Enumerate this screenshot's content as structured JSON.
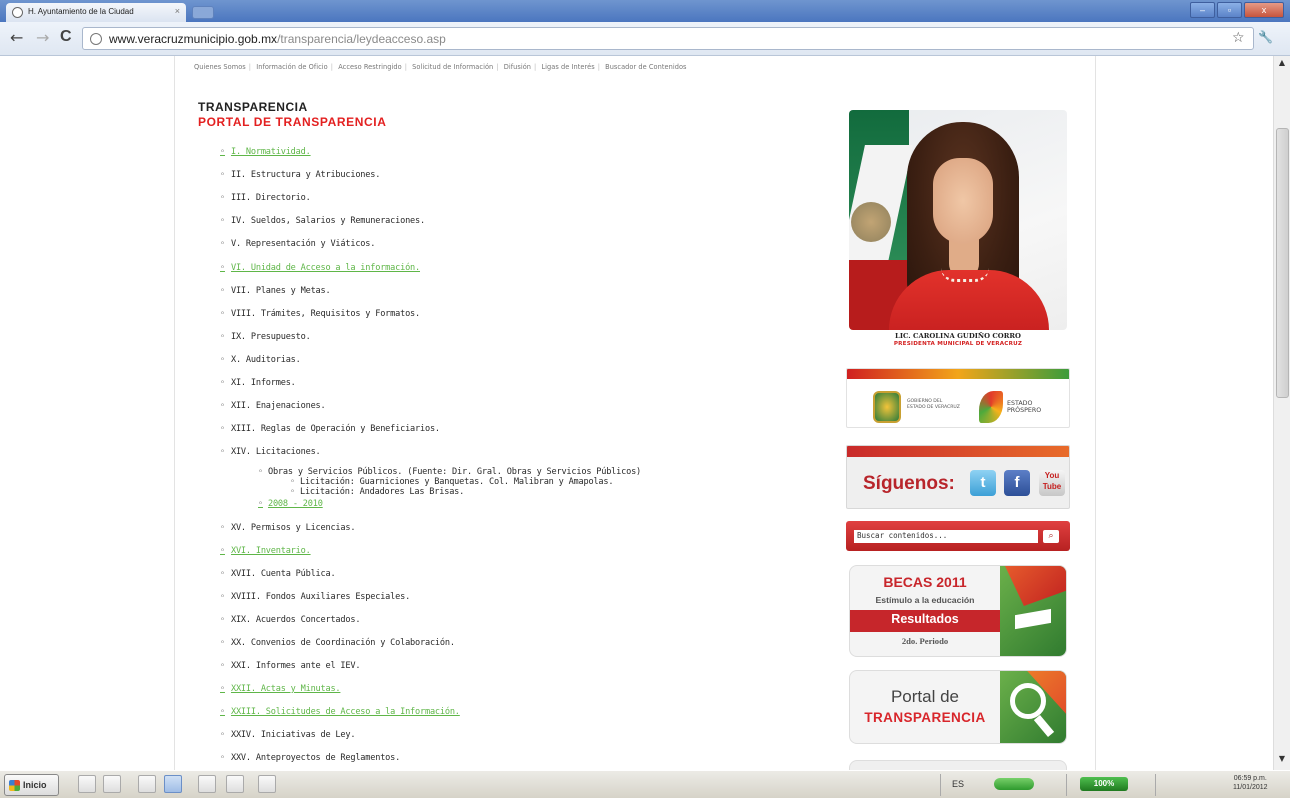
{
  "browser": {
    "tab_title": "H. Ayuntamiento de la Ciudad",
    "tab_close": "×",
    "url_host": "www.veracruzmunicipio.gob.mx",
    "url_path": "/transparencia/leydeacceso.asp",
    "back_icon": "←",
    "forward_icon": "→",
    "reload_icon": "C",
    "star_icon": "☆",
    "wrench_icon": "🔧",
    "window_buttons": [
      "–",
      "▫",
      "x"
    ]
  },
  "topnav": {
    "items": [
      "Quienes Somos",
      "Información de Oficio",
      "Acceso Restringido",
      "Solicitud de Información",
      "Difusión",
      "Ligas de Interés",
      "Buscador de Contenidos"
    ],
    "separator": "|"
  },
  "page": {
    "title": "TRANSPARENCIA",
    "subtitle": "PORTAL DE TRANSPARENCIA",
    "items": [
      {
        "label": "I. Normatividad.",
        "link": true
      },
      {
        "label": "II. Estructura y Atribuciones.",
        "link": false
      },
      {
        "label": "III. Directorio.",
        "link": false
      },
      {
        "label": "IV. Sueldos, Salarios y Remuneraciones.",
        "link": false
      },
      {
        "label": "V. Representación y Viáticos.",
        "link": false
      },
      {
        "label": "VI. Unidad de Acceso a la información.",
        "link": true
      },
      {
        "label": "VII. Planes y Metas.",
        "link": false
      },
      {
        "label": "VIII. Trámites, Requisitos y Formatos.",
        "link": false
      },
      {
        "label": "IX. Presupuesto.",
        "link": false
      },
      {
        "label": "X. Auditorias.",
        "link": false
      },
      {
        "label": "XI. Informes.",
        "link": false
      },
      {
        "label": "XII. Enajenaciones.",
        "link": false
      },
      {
        "label": "XIII. Reglas de Operación y Beneficiarios.",
        "link": false
      },
      {
        "label": "XIV. Licitaciones.",
        "link": false
      },
      {
        "label": "XV. Permisos y Licencias.",
        "link": false
      },
      {
        "label": "XVI. Inventario.",
        "link": true
      },
      {
        "label": "XVII. Cuenta Pública.",
        "link": false
      },
      {
        "label": "XVIII. Fondos Auxiliares Especiales.",
        "link": false
      },
      {
        "label": "XIX. Acuerdos Concertados.",
        "link": false
      },
      {
        "label": "XX. Convenios de Coordinación y Colaboración.",
        "link": false
      },
      {
        "label": "XXI. Informes ante el IEV.",
        "link": false
      },
      {
        "label": "XXII. Actas y Minutas.",
        "link": true
      },
      {
        "label": "XXIII. Solicitudes de Acceso a la Información.",
        "link": true
      },
      {
        "label": "XXIV. Iniciativas de Ley.",
        "link": false
      },
      {
        "label": "XXV. Anteproyectos de Reglamentos.",
        "link": false
      }
    ],
    "licitaciones_sub": {
      "obras": "Obras y Servicios Públicos. (Fuente: Dir. Gral. Obras y Servicios Públicos)",
      "lic1": "Licitación: Guarniciones y Banquetas. Col. Malibran y Amapolas.",
      "lic2": "Licitación: Andadores Las Brisas.",
      "years": "2008 - 2010"
    }
  },
  "sidebar": {
    "portrait_name": "LIC. CAROLINA GUDIÑO CORRO",
    "portrait_title": "PRESIDENTA MUNICIPAL DE VERACRUZ",
    "gob_text_1": "GOBIERNO DEL",
    "gob_text_2": "ESTADO DE VERACRUZ",
    "estado_1": "ESTADO",
    "estado_2": "PRÓSPERO",
    "siguenos": "Síguenos:",
    "twitter": "t",
    "facebook": "f",
    "youtube": "You Tube",
    "search_placeholder": "Buscar contenidos...",
    "search_go": "⌕",
    "becas_title": "BECAS 2011",
    "becas_sub": "Estímulo a la educación",
    "becas_result": "Resultados",
    "becas_period": "2do. Periodo",
    "portal_1": "Portal de",
    "portal_2": "TRANSPARENCIA"
  },
  "taskbar": {
    "start_label": "Inicio",
    "language": "ES",
    "battery_label": "100%",
    "time": "06:59 p.m.",
    "date": "11/01/2012"
  }
}
